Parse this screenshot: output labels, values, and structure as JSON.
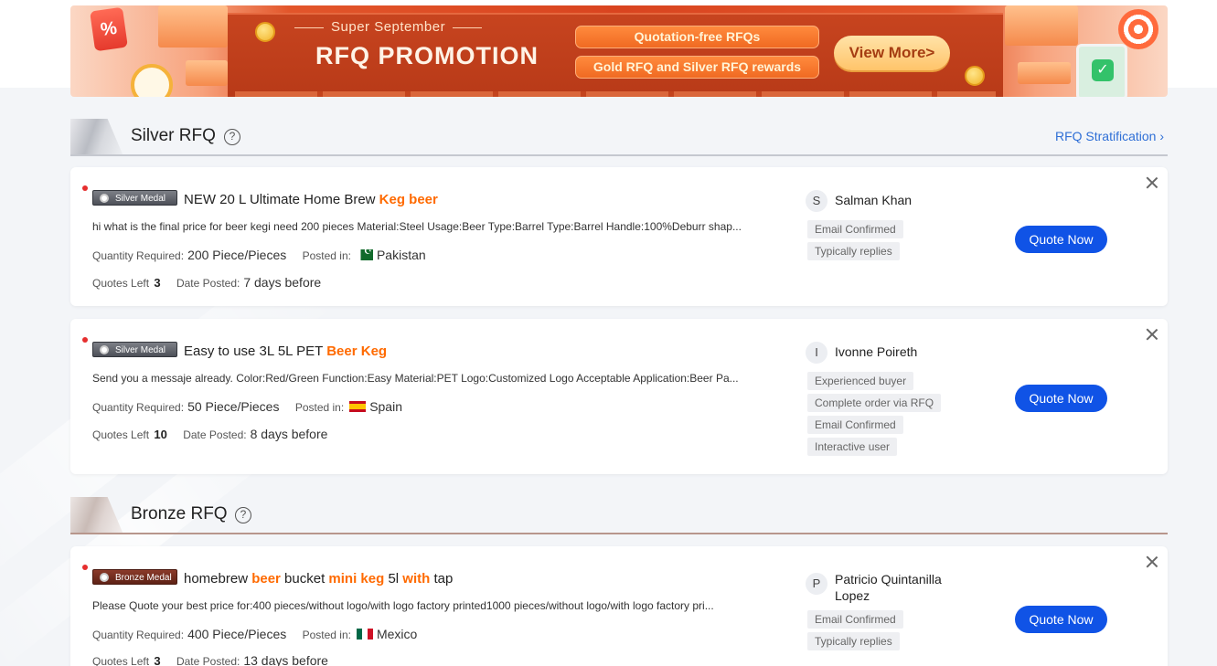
{
  "banner": {
    "super": "Super September",
    "title": "RFQ PROMOTION",
    "pill1": "Quotation-free RFQs",
    "pill2": "Gold RFQ and Silver RFQ rewards",
    "view_more": "View More>",
    "percent": "%"
  },
  "silver_section": {
    "title": "Silver RFQ",
    "help": "?",
    "link": "RFQ Stratification"
  },
  "bronze_section": {
    "title": "Bronze RFQ",
    "help": "?"
  },
  "labels": {
    "quantity_required": "Quantity Required:",
    "posted_in": "Posted in:",
    "quotes_left": "Quotes Left",
    "date_posted": "Date Posted:",
    "quote_now": "Quote Now"
  },
  "cards": [
    {
      "medal": "Silver Medal",
      "title_parts": [
        "NEW 20 L Ultimate Home Brew ",
        "Keg beer"
      ],
      "description": "hi what is the final price for beer kegi need 200 pieces Material:Steel Usage:Beer Type:Barrel Type:Barrel Handle:100%Deburr shap...",
      "quantity": "200 Piece/Pieces",
      "country": "Pakistan",
      "quotes_left": "3",
      "date_posted": "7 days before",
      "buyer_initial": "S",
      "buyer_name": "Salman Khan",
      "tags": [
        "Email Confirmed",
        "Typically replies"
      ]
    },
    {
      "medal": "Silver Medal",
      "title_parts": [
        "Easy to use 3L 5L PET ",
        "Beer Keg"
      ],
      "description": "Send you a messaje already. Color:Red/Green Function:Easy Material:PET Logo:Customized Logo Acceptable Application:Beer Pa...",
      "quantity": "50 Piece/Pieces",
      "country": "Spain",
      "quotes_left": "10",
      "date_posted": "8 days before",
      "buyer_initial": "I",
      "buyer_name": "Ivonne Poireth",
      "tags": [
        "Experienced buyer",
        "Complete order via RFQ",
        "Email Confirmed",
        "Interactive user"
      ]
    },
    {
      "medal": "Bronze Medal",
      "title_parts": [
        "homebrew ",
        "beer",
        " bucket ",
        "mini keg",
        " 5l ",
        "with",
        " tap"
      ],
      "description": "Please Quote your best price for:400 pieces/without logo/with logo factory printed1000 pieces/without logo/with logo factory pri...",
      "quantity": "400 Piece/Pieces",
      "country": "Mexico",
      "quotes_left": "3",
      "date_posted": "13 days before",
      "buyer_initial": "P",
      "buyer_name": "Patricio Quintanilla Lopez",
      "tags": [
        "Email Confirmed",
        "Typically replies"
      ]
    }
  ]
}
